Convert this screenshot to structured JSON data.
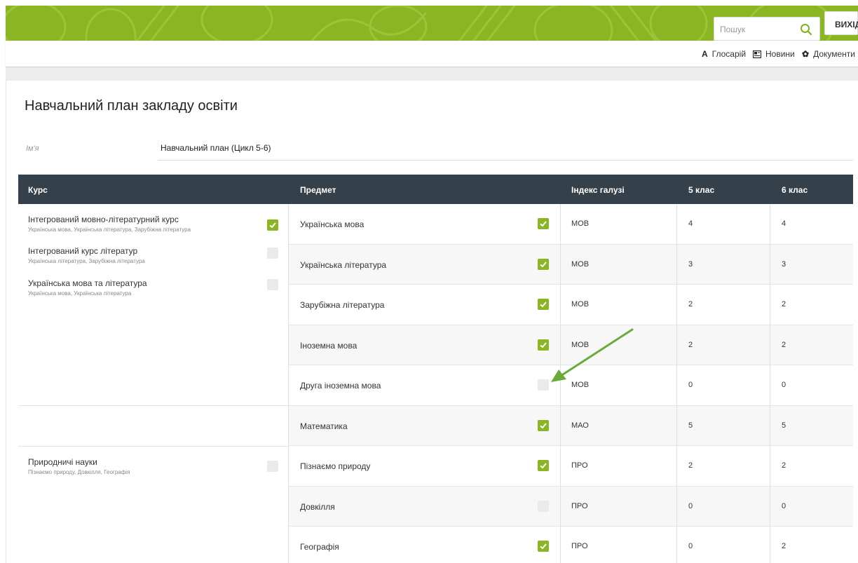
{
  "header": {
    "search_placeholder": "Пошук",
    "exit_label": "ВИХІД",
    "brand_color": "#8ab623"
  },
  "subnav": {
    "glossary_icon": "А",
    "glossary": "Глосарій",
    "news": "Новини",
    "documents": "Документи"
  },
  "page": {
    "title": "Навчальний план закладу освіти",
    "name_label": "Ім'я",
    "name_value": "Навчальний план (Цикл 5-6)"
  },
  "table": {
    "headers": [
      "Курс",
      "Предмет",
      "Індекс галузі",
      "5 клас",
      "6 клас"
    ],
    "courses": [
      {
        "title": "Інтегрований мовно-літературний курс",
        "subjects": "Українська мова, Українська література, Зарубіжна література",
        "checked": true
      },
      {
        "title": "Інтегрований курс літератур",
        "subjects": "Українська література, Зарубіжна література",
        "checked": false
      },
      {
        "title": "Українська мова та література",
        "subjects": "Українська мова, Українська література",
        "checked": false
      },
      {
        "title": "Природничі науки",
        "subjects": "Пізнаємо природу, Довкілля, Географія",
        "checked": false
      }
    ],
    "rows": [
      {
        "subject": "Українська мова",
        "checked": true,
        "index": "МОВ",
        "grade5": "4",
        "grade6": "4"
      },
      {
        "subject": "Українська література",
        "checked": true,
        "index": "МОВ",
        "grade5": "3",
        "grade6": "3"
      },
      {
        "subject": "Зарубіжна література",
        "checked": true,
        "index": "МОВ",
        "grade5": "2",
        "grade6": "2"
      },
      {
        "subject": "Іноземна мова",
        "checked": true,
        "index": "МОВ",
        "grade5": "2",
        "grade6": "2"
      },
      {
        "subject": "Друга іноземна мова",
        "checked": false,
        "index": "МОВ",
        "grade5": "0",
        "grade6": "0"
      },
      {
        "subject": "Математика",
        "checked": true,
        "index": "МАО",
        "grade5": "5",
        "grade6": "5"
      },
      {
        "subject": "Пізнаємо природу",
        "checked": true,
        "index": "ПРО",
        "grade5": "2",
        "grade6": "2"
      },
      {
        "subject": "Довкілля",
        "checked": false,
        "index": "ПРО",
        "grade5": "0",
        "grade6": "0"
      },
      {
        "subject": "Географія",
        "checked": true,
        "index": "ПРО",
        "grade5": "0",
        "grade6": "2"
      }
    ]
  },
  "annotation": {
    "arrow_color": "#6aaa3a"
  }
}
